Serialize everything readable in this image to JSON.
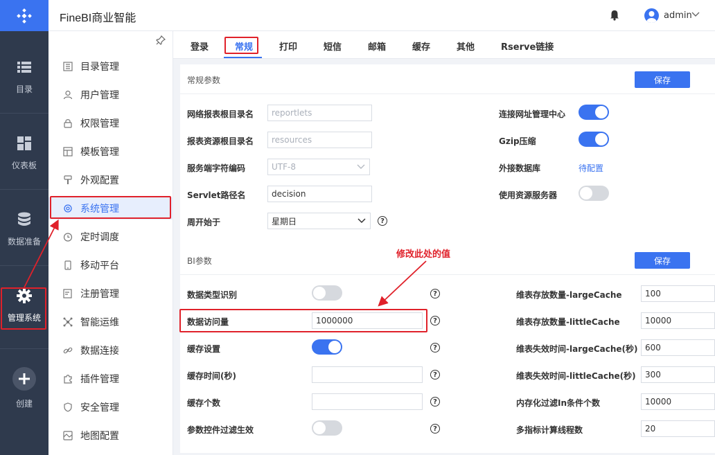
{
  "app": {
    "title": "FineBI商业智能",
    "user": "admin"
  },
  "leftnav": [
    {
      "label": "目录",
      "icon": "list-icon"
    },
    {
      "label": "仪表板",
      "icon": "dashboard-icon"
    },
    {
      "label": "数据准备",
      "icon": "database-icon"
    },
    {
      "label": "管理系统",
      "icon": "gear-icon"
    },
    {
      "label": "创建",
      "icon": "plus-icon"
    }
  ],
  "sidebar": [
    {
      "label": "目录管理",
      "icon": "catalog-icon"
    },
    {
      "label": "用户管理",
      "icon": "user-icon"
    },
    {
      "label": "权限管理",
      "icon": "lock-icon"
    },
    {
      "label": "模板管理",
      "icon": "template-icon"
    },
    {
      "label": "外观配置",
      "icon": "paint-icon"
    },
    {
      "label": "系统管理",
      "icon": "settings-icon"
    },
    {
      "label": "定时调度",
      "icon": "clock-icon"
    },
    {
      "label": "移动平台",
      "icon": "mobile-icon"
    },
    {
      "label": "注册管理",
      "icon": "register-icon"
    },
    {
      "label": "智能运维",
      "icon": "network-icon"
    },
    {
      "label": "数据连接",
      "icon": "link-icon"
    },
    {
      "label": "插件管理",
      "icon": "puzzle-icon"
    },
    {
      "label": "安全管理",
      "icon": "shield-icon"
    },
    {
      "label": "地图配置",
      "icon": "map-icon"
    }
  ],
  "tabs": [
    "登录",
    "常规",
    "打印",
    "短信",
    "邮箱",
    "缓存",
    "其他",
    "Rserve链接"
  ],
  "general": {
    "title": "常规参数",
    "save": "保存",
    "report_root_label": "网络报表根目录名",
    "report_root_value": "reportlets",
    "resource_root_label": "报表资源根目录名",
    "resource_root_value": "resources",
    "encoding_label": "服务端字符编码",
    "encoding_value": "UTF-8",
    "servlet_label": "Servlet路径名",
    "servlet_value": "decision",
    "week_label": "周开始于",
    "week_value": "星期日",
    "url_mgmt_label": "连接网址管理中心",
    "url_mgmt_on": true,
    "gzip_label": "Gzip压缩",
    "gzip_on": true,
    "ext_db_label": "外接数据库",
    "ext_db_value": "待配置",
    "resource_server_label": "使用资源服务器",
    "resource_server_on": false
  },
  "bi": {
    "title": "BI参数",
    "save": "保存",
    "annotation": "修改此处的值",
    "type_detect_label": "数据类型识别",
    "type_detect_on": false,
    "access_label": "数据访问量",
    "access_value": "1000000",
    "cache_label": "缓存设置",
    "cache_on": true,
    "cache_time_label": "缓存时间(秒)",
    "cache_time_value": "",
    "cache_count_label": "缓存个数",
    "cache_count_value": "",
    "param_filter_label": "参数控件过滤生效",
    "param_filter_on": false,
    "large_cache_label": "维表存放数量-largeCache",
    "large_cache_value": "100",
    "little_cache_label": "维表存放数量-littleCache",
    "little_cache_value": "10000",
    "large_expire_label": "维表失效时间-largeCache(秒)",
    "large_expire_value": "600",
    "little_expire_label": "维表失效时间-littleCache(秒)",
    "little_expire_value": "300",
    "in_filter_label": "内存化过滤In条件个数",
    "in_filter_value": "10000",
    "threads_label": "多指标计算线程数",
    "threads_value": "20"
  },
  "colors": {
    "accent": "#3a73f0",
    "annotation": "#e0212a",
    "nav_bg": "#2f3a4d"
  }
}
